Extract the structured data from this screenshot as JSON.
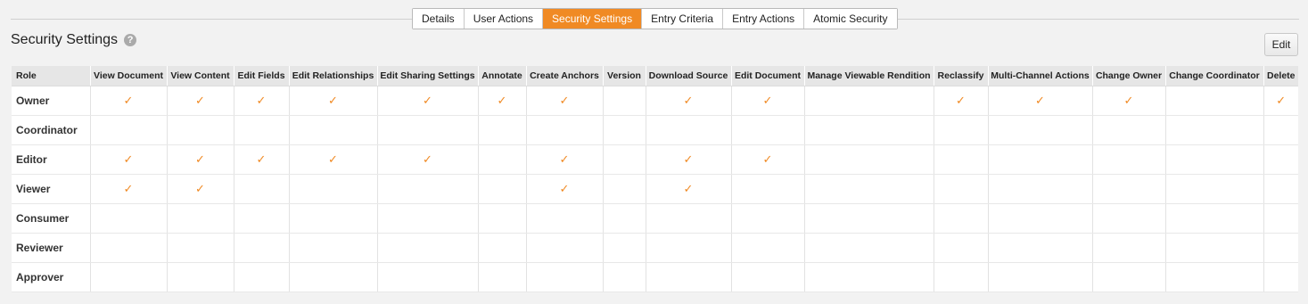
{
  "tabs": [
    {
      "label": "Details",
      "active": false
    },
    {
      "label": "User Actions",
      "active": false
    },
    {
      "label": "Security Settings",
      "active": true
    },
    {
      "label": "Entry Criteria",
      "active": false
    },
    {
      "label": "Entry Actions",
      "active": false
    },
    {
      "label": "Atomic Security",
      "active": false
    }
  ],
  "page_title": "Security Settings",
  "help_icon": "?",
  "edit_label": "Edit",
  "colors": {
    "accent": "#f08a24"
  },
  "check_mark": "✓",
  "table": {
    "headers": [
      "Role",
      "View Document",
      "View Content",
      "Edit Fields",
      "Edit Relationships",
      "Edit Sharing Settings",
      "Annotate",
      "Create Anchors",
      "Version",
      "Download Source",
      "Edit Document",
      "Manage Viewable Rendition",
      "Reclassify",
      "Multi-Channel Actions",
      "Change Owner",
      "Change Coordinator",
      "Delete"
    ],
    "rows": [
      {
        "role": "Owner",
        "perms": [
          1,
          1,
          1,
          1,
          1,
          1,
          1,
          0,
          1,
          1,
          0,
          1,
          1,
          1,
          0,
          1
        ]
      },
      {
        "role": "Coordinator",
        "perms": [
          0,
          0,
          0,
          0,
          0,
          0,
          0,
          0,
          0,
          0,
          0,
          0,
          0,
          0,
          0,
          0
        ]
      },
      {
        "role": "Editor",
        "perms": [
          1,
          1,
          1,
          1,
          1,
          0,
          1,
          0,
          1,
          1,
          0,
          0,
          0,
          0,
          0,
          0
        ]
      },
      {
        "role": "Viewer",
        "perms": [
          1,
          1,
          0,
          0,
          0,
          0,
          1,
          0,
          1,
          0,
          0,
          0,
          0,
          0,
          0,
          0
        ]
      },
      {
        "role": "Consumer",
        "perms": [
          0,
          0,
          0,
          0,
          0,
          0,
          0,
          0,
          0,
          0,
          0,
          0,
          0,
          0,
          0,
          0
        ]
      },
      {
        "role": "Reviewer",
        "perms": [
          0,
          0,
          0,
          0,
          0,
          0,
          0,
          0,
          0,
          0,
          0,
          0,
          0,
          0,
          0,
          0
        ]
      },
      {
        "role": "Approver",
        "perms": [
          0,
          0,
          0,
          0,
          0,
          0,
          0,
          0,
          0,
          0,
          0,
          0,
          0,
          0,
          0,
          0
        ]
      }
    ]
  }
}
